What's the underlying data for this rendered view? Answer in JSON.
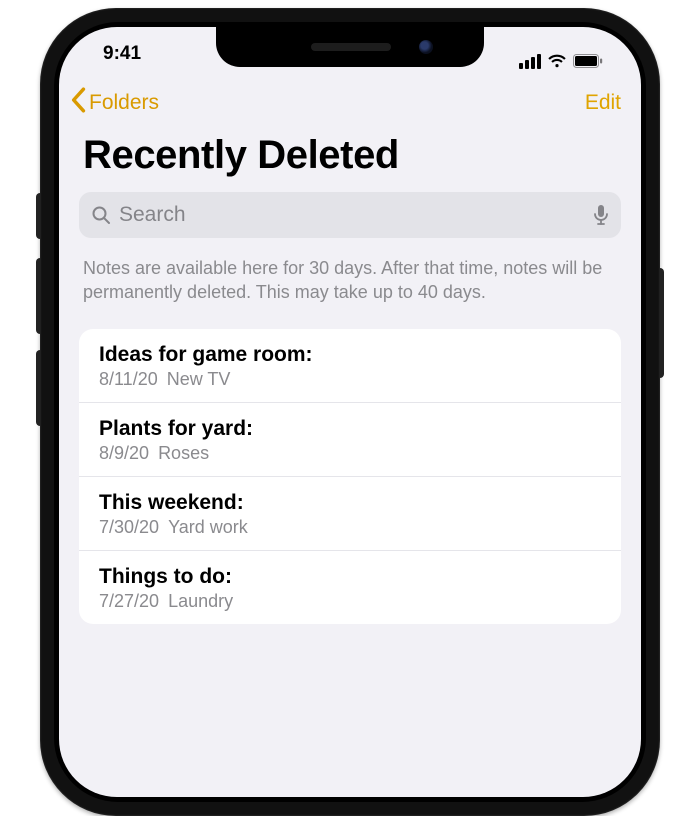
{
  "status": {
    "time": "9:41"
  },
  "nav": {
    "back": "Folders",
    "edit": "Edit"
  },
  "title": "Recently Deleted",
  "search": {
    "placeholder": "Search"
  },
  "info": "Notes are available here for 30 days. After that time, notes will be permanently deleted. This may take up to 40 days.",
  "notes": [
    {
      "title": "Ideas for game room:",
      "date": "8/11/20",
      "preview": "New TV"
    },
    {
      "title": "Plants for yard:",
      "date": "8/9/20",
      "preview": "Roses"
    },
    {
      "title": "This weekend:",
      "date": "7/30/20",
      "preview": "Yard work"
    },
    {
      "title": "Things to do:",
      "date": "7/27/20",
      "preview": "Laundry"
    }
  ]
}
